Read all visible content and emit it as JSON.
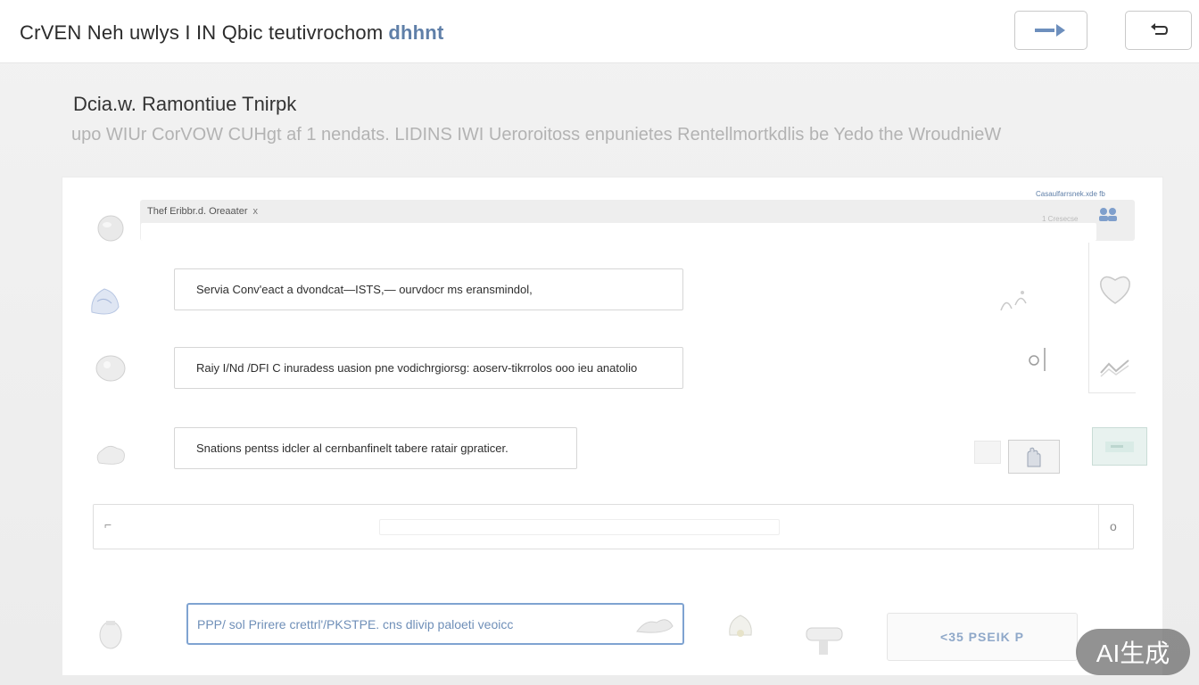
{
  "header": {
    "title": "CrVEN Neh uwlys I IN Qbic teutivrochom",
    "title_accent": "dhhnt",
    "forward_icon": "arrow-right-icon",
    "back_icon": "return-arrow-icon"
  },
  "page": {
    "heading": "Dcia.w. Ramontiue Tnirpk",
    "subheading": "upo WIUr CorVOW CUHgt af 1 nendats. LIDINS IWI Ueroroitoss enpunietes Rentellmortkdlis be Yedo the WroudnieW"
  },
  "tab": {
    "label": "Thef Eribbr.d. Oreaater",
    "close": "x",
    "meta_top": "Casaulfarrsnek.xde fb",
    "meta_sub": "1 Cresecse"
  },
  "rows": [
    {
      "text": "Servia Conv'eact a dvondcat—ISTS,— ourvdocr ms eransmindol,",
      "left_icon": "globe-icon",
      "right_icon": "sparkle-icon"
    },
    {
      "text": "Raiy I/Nd /DFI C inuradess uasion pne vodichrgiorsg: aoserv-tikrrolos ooo ieu anatolio",
      "left_icon": "sphere-icon",
      "right_icon": "search-icon"
    },
    {
      "text": "Snations pentss idcler al cernbanfinelt tabere ratair gpraticer.",
      "left_icon": "cloud-icon",
      "right_icon": "hand-icon"
    }
  ],
  "rail": {
    "icon_1": "heart-icon",
    "icon_2": "chart-line-icon",
    "icon_3": "image-thumbnail-icon"
  },
  "search": {
    "prefix": "⌐",
    "dot": "o"
  },
  "prompt": {
    "placeholder": "PPP/ sol Prirere crettrl'/PKSTPE. cns dlivip paloeti veoicc"
  },
  "actions": {
    "pill_label": "<35 PSEIK P",
    "watermark": "AI生成"
  },
  "colors": {
    "accent": "#5f7fa8",
    "focus_border": "#7fa3d1",
    "watermark_bg": "#6e6e6e"
  }
}
